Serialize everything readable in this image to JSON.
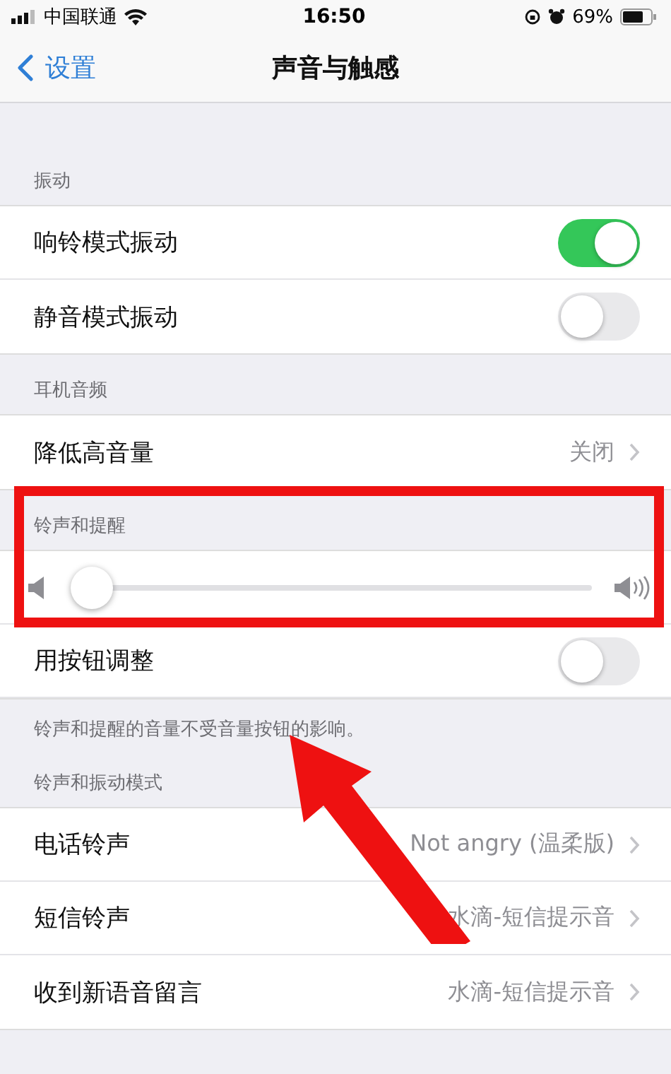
{
  "status_bar": {
    "carrier": "中国联通",
    "time": "16:50",
    "battery": "69%"
  },
  "nav": {
    "back": "设置",
    "title": "声音与触感"
  },
  "sections": [
    {
      "header": "振动",
      "rows": [
        {
          "kind": "toggle",
          "label": "响铃模式振动",
          "on": true
        },
        {
          "kind": "toggle",
          "label": "静音模式振动",
          "on": false
        }
      ]
    },
    {
      "header": "耳机音频",
      "rows": [
        {
          "kind": "link",
          "label": "降低高音量",
          "value": "关闭"
        }
      ]
    },
    {
      "header": "铃声和提醒",
      "highlighted": true,
      "rows": [
        {
          "kind": "slider",
          "level": 0.0
        },
        {
          "kind": "toggle",
          "label": "用按钮调整",
          "on": false
        }
      ],
      "footer": "铃声和提醒的音量不受音量按钮的影响。"
    },
    {
      "header": "铃声和振动模式",
      "rows": [
        {
          "kind": "link",
          "label": "电话铃声",
          "value": "Not angry (温柔版)"
        },
        {
          "kind": "link",
          "label": "短信铃声",
          "value": "水滴-短信提示音"
        },
        {
          "kind": "link",
          "label": "收到新语音留言",
          "value": "水滴-短信提示音"
        }
      ]
    }
  ]
}
